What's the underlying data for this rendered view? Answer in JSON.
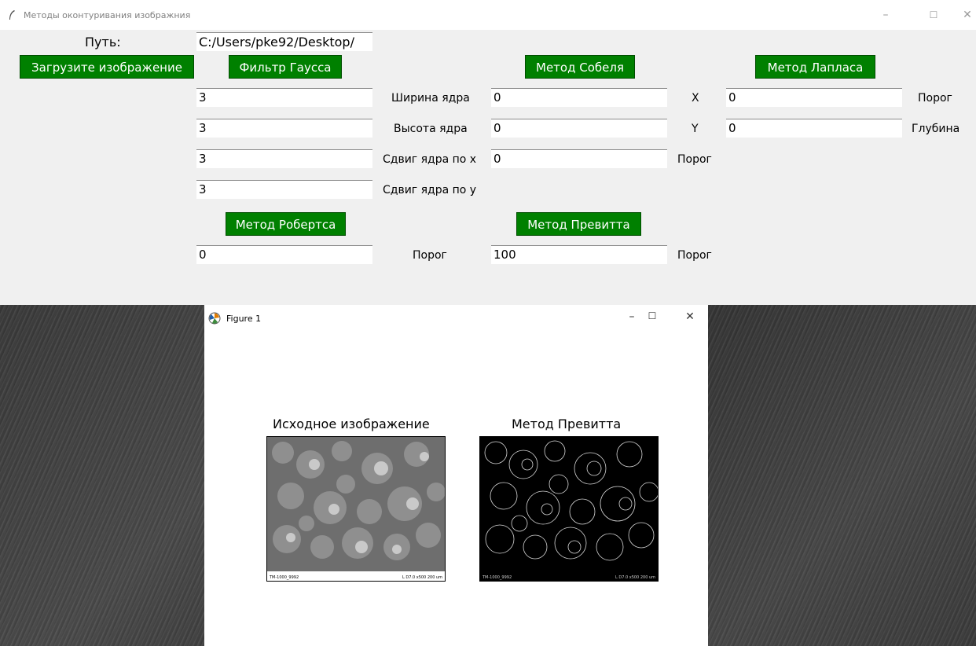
{
  "window": {
    "title": "Методы оконтуривания изображния",
    "minimize": "–",
    "maximize": "☐",
    "close": "✕"
  },
  "path": {
    "label": "Путь:",
    "value": "C:/Users/pke92/Desktop/"
  },
  "buttons": {
    "load": "Загрузите изображение",
    "gauss": "Фильтр Гаусса",
    "sobel": "Метод Собеля",
    "laplace": "Метод Лапласа",
    "roberts": "Метод Робертса",
    "prewitt": "Метод Превитта"
  },
  "gauss": {
    "fields": [
      "3",
      "3",
      "3",
      "3"
    ],
    "labels": [
      "Ширина ядра",
      "Высота ядра",
      "Сдвиг ядра по x",
      "Сдвиг ядра по y"
    ]
  },
  "sobel": {
    "fields": [
      "0",
      "0",
      "0"
    ],
    "labels": [
      "X",
      "Y",
      "Порог"
    ]
  },
  "laplace": {
    "fields": [
      "0",
      "0"
    ],
    "labels": [
      "Порог",
      "Глубина"
    ]
  },
  "roberts": {
    "field": "0",
    "label": "Порог"
  },
  "prewitt": {
    "field": "100",
    "label": "Порог"
  },
  "figure": {
    "title": "Figure 1",
    "minimize": "–",
    "maximize": "☐",
    "close": "✕",
    "left_title": "Исходное изображение",
    "right_title": "Метод Превитта",
    "sem_left_text": "TM-1000_9992",
    "sem_right_text": "L D7.0  x500   200 um"
  },
  "icons": {
    "app": "feather-icon",
    "figure": "matplotlib-icon"
  }
}
